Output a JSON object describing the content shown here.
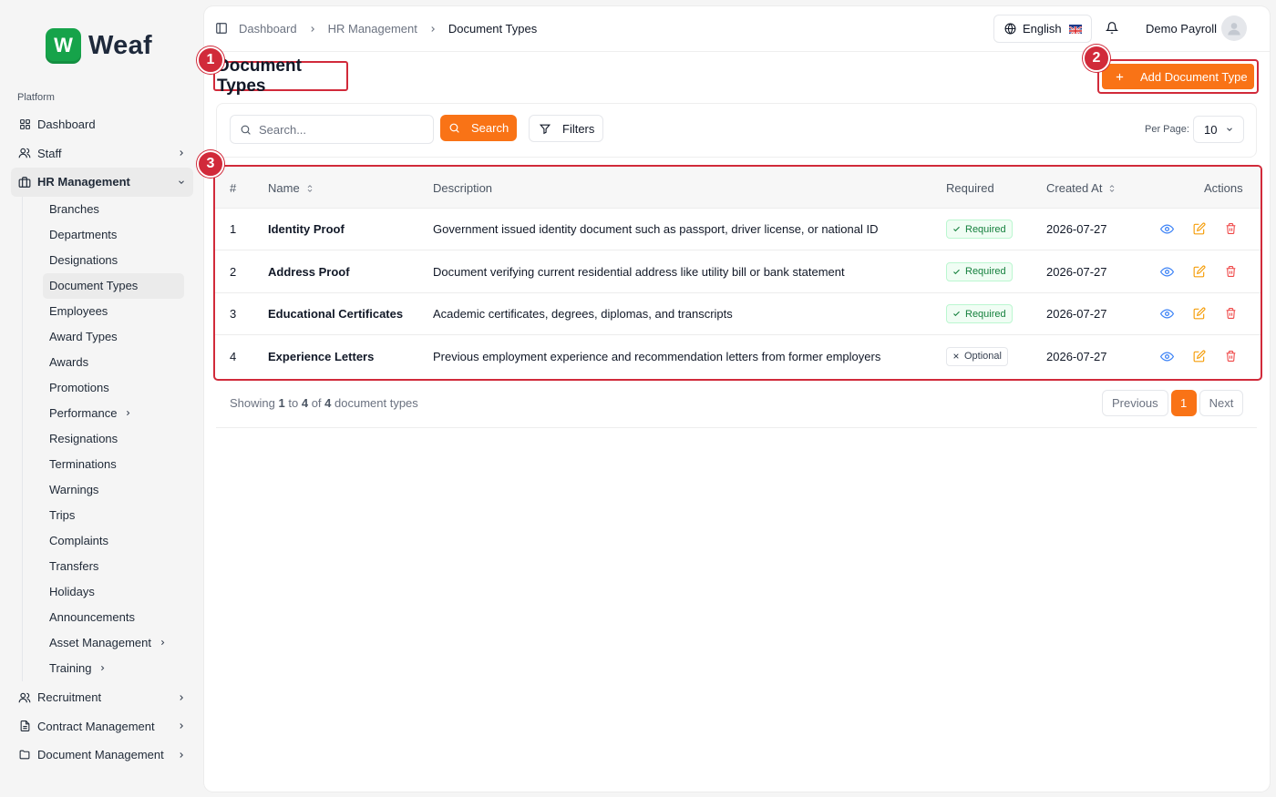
{
  "brand": {
    "logo_letter": "W",
    "name": "Weaf",
    "color": "#16a34a"
  },
  "sidebar": {
    "section_label": "Platform",
    "top_items": [
      {
        "label": "Dashboard",
        "icon": "grid-icon"
      },
      {
        "label": "Staff",
        "icon": "users-icon"
      }
    ],
    "hr": {
      "label": "HR Management",
      "icon": "briefcase-icon"
    },
    "hr_subitems": [
      {
        "label": "Branches"
      },
      {
        "label": "Departments"
      },
      {
        "label": "Designations"
      },
      {
        "label": "Document Types"
      },
      {
        "label": "Employees"
      },
      {
        "label": "Award Types"
      },
      {
        "label": "Awards"
      },
      {
        "label": "Promotions"
      },
      {
        "label": "Performance"
      },
      {
        "label": "Resignations"
      },
      {
        "label": "Terminations"
      },
      {
        "label": "Warnings"
      },
      {
        "label": "Trips"
      },
      {
        "label": "Complaints"
      },
      {
        "label": "Transfers"
      },
      {
        "label": "Holidays"
      },
      {
        "label": "Announcements"
      },
      {
        "label": "Asset Management"
      },
      {
        "label": "Training"
      }
    ],
    "bottom_items": [
      {
        "label": "Recruitment",
        "icon": "users-icon"
      },
      {
        "label": "Contract Management",
        "icon": "file-icon"
      },
      {
        "label": "Document Management",
        "icon": "folder-icon"
      }
    ]
  },
  "header": {
    "breadcrumb": [
      "Dashboard",
      "HR Management",
      "Document Types"
    ],
    "language": "English",
    "user_name": "Demo Payroll"
  },
  "page": {
    "title": "Document Types",
    "add_button": "Add Document Type",
    "markers": [
      "1",
      "2",
      "3"
    ]
  },
  "filters": {
    "search_placeholder": "Search...",
    "search_button": "Search",
    "filters_button": "Filters",
    "per_page_label": "Per Page:",
    "per_page_value": "10"
  },
  "table": {
    "columns": {
      "index": "#",
      "name": "Name",
      "description": "Description",
      "required": "Required",
      "created_at": "Created At",
      "actions": "Actions"
    },
    "rows": [
      {
        "index": "1",
        "name": "Identity Proof",
        "description": "Government issued identity document such as passport, driver license, or national ID",
        "status": "Required",
        "created_at": "2026-07-27"
      },
      {
        "index": "2",
        "name": "Address Proof",
        "description": "Document verifying current residential address like utility bill or bank statement",
        "status": "Required",
        "created_at": "2026-07-27"
      },
      {
        "index": "3",
        "name": "Educational Certificates",
        "description": "Academic certificates, degrees, diplomas, and transcripts",
        "status": "Required",
        "created_at": "2026-07-27"
      },
      {
        "index": "4",
        "name": "Experience Letters",
        "description": "Previous employment experience and recommendation letters from former employers",
        "status": "Optional",
        "created_at": "2026-07-27"
      }
    ]
  },
  "pagination": {
    "showing": "Showing",
    "from": "1",
    "to_word": "to",
    "to": "4",
    "of_word": "of",
    "total": "4",
    "suffix": "document types",
    "previous": "Previous",
    "current_page": "1",
    "next": "Next"
  },
  "colors": {
    "accent": "#f97316",
    "highlight": "#d12a3a",
    "view": "#3b82f6",
    "edit": "#f59e0b",
    "delete": "#ef4444"
  }
}
